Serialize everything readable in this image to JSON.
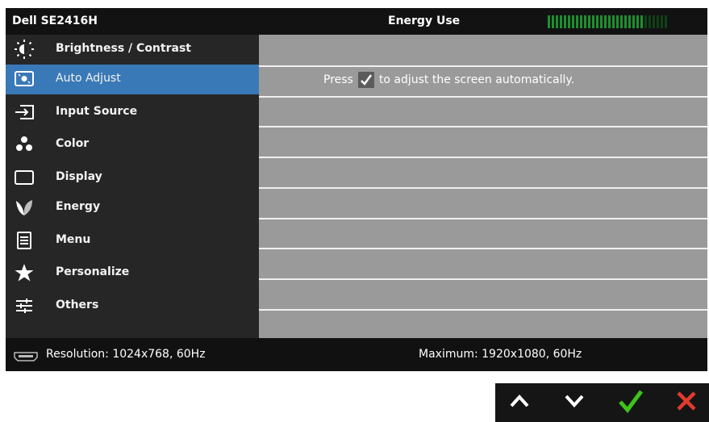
{
  "header": {
    "model": "Dell SE2416H",
    "energy_label": "Energy Use",
    "energy_level": 0.8
  },
  "menu": {
    "items": [
      {
        "label": "Brightness / Contrast",
        "icon": "brightness-icon"
      },
      {
        "label": "Auto Adjust",
        "icon": "auto-adjust-icon",
        "selected": true
      },
      {
        "label": "Input Source",
        "icon": "input-source-icon"
      },
      {
        "label": "Color",
        "icon": "color-icon"
      },
      {
        "label": "Display",
        "icon": "display-icon"
      },
      {
        "label": "Energy",
        "icon": "energy-icon"
      },
      {
        "label": "Menu",
        "icon": "menu-icon"
      },
      {
        "label": "Personalize",
        "icon": "star-icon"
      },
      {
        "label": "Others",
        "icon": "others-icon"
      }
    ]
  },
  "panel": {
    "message_prefix": "Press",
    "message_suffix": "to adjust the screen automatically."
  },
  "footer": {
    "resolution": "Resolution: 1024x768, 60Hz",
    "maximum": "Maximum: 1920x1080, 60Hz"
  },
  "buttons": {
    "up": "up-arrow-icon",
    "down": "down-arrow-icon",
    "confirm": "check-icon",
    "exit": "close-icon"
  },
  "colors": {
    "selected": "#3a79b7",
    "confirm": "#3ec31a",
    "exit": "#e23a2e",
    "meter": "#1e8f2f"
  }
}
